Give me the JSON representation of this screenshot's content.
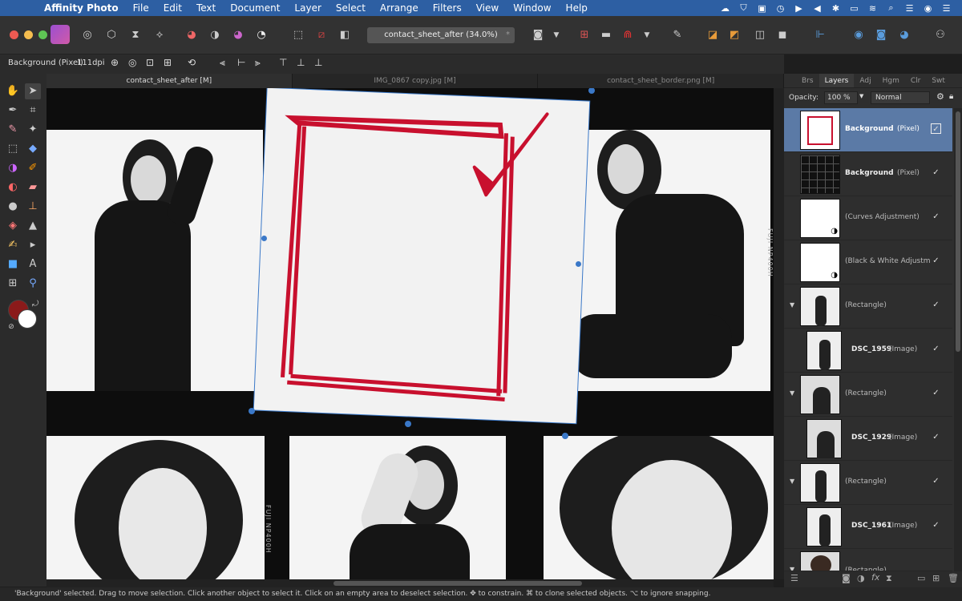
{
  "menubar": {
    "app_name": "Affinity Photo",
    "items": [
      "File",
      "Edit",
      "Text",
      "Document",
      "Layer",
      "Select",
      "Arrange",
      "Filters",
      "View",
      "Window",
      "Help"
    ]
  },
  "toolbar": {
    "document_title": "contact_sheet_after (34.0%)",
    "modified_marker": "*"
  },
  "context": {
    "layer_info": "Background (Pixel)",
    "dpi": "111dpi"
  },
  "tabs": [
    {
      "label": "contact_sheet_after [M]"
    },
    {
      "label": "IMG_0867 copy.jpg [M]"
    },
    {
      "label": "contact_sheet_border.png [M]"
    }
  ],
  "panel": {
    "tabs": [
      "Brs",
      "Layers",
      "Adj",
      "Hgm",
      "Clr",
      "Swt"
    ],
    "opacity_label": "Opacity:",
    "opacity_value": "100 %",
    "blend_mode": "Normal",
    "layers": [
      {
        "name": "Background",
        "type": "(Pixel)",
        "selected": true
      },
      {
        "name": "Background",
        "type": "(Pixel)"
      },
      {
        "name": "",
        "type": "(Curves Adjustment)"
      },
      {
        "name": "",
        "type": "(Black & White Adjustmer"
      },
      {
        "name": "",
        "type": "(Rectangle)"
      },
      {
        "name": "DSC_1959",
        "type": "(Image)"
      },
      {
        "name": "",
        "type": "(Rectangle)"
      },
      {
        "name": "DSC_1929",
        "type": "(Image)"
      },
      {
        "name": "",
        "type": "(Rectangle)"
      },
      {
        "name": "DSC_1961",
        "type": "(Image)"
      },
      {
        "name": "",
        "type": "(Rectangle)"
      }
    ]
  },
  "status": {
    "text": "'Background' selected. Drag to move selection. Click another object to select it. Click on an empty area to deselect selection. ✥ to constrain. ⌘ to clone selected objects. ⌥ to ignore snapping."
  },
  "colors": {
    "menubar": "#2d5fa3",
    "selection": "#5b7aa6",
    "primary_color": "#8b1a1a",
    "secondary_color": "#ffffff",
    "marker_red": "#c8102e"
  },
  "film_text": "FUJI NP400H"
}
